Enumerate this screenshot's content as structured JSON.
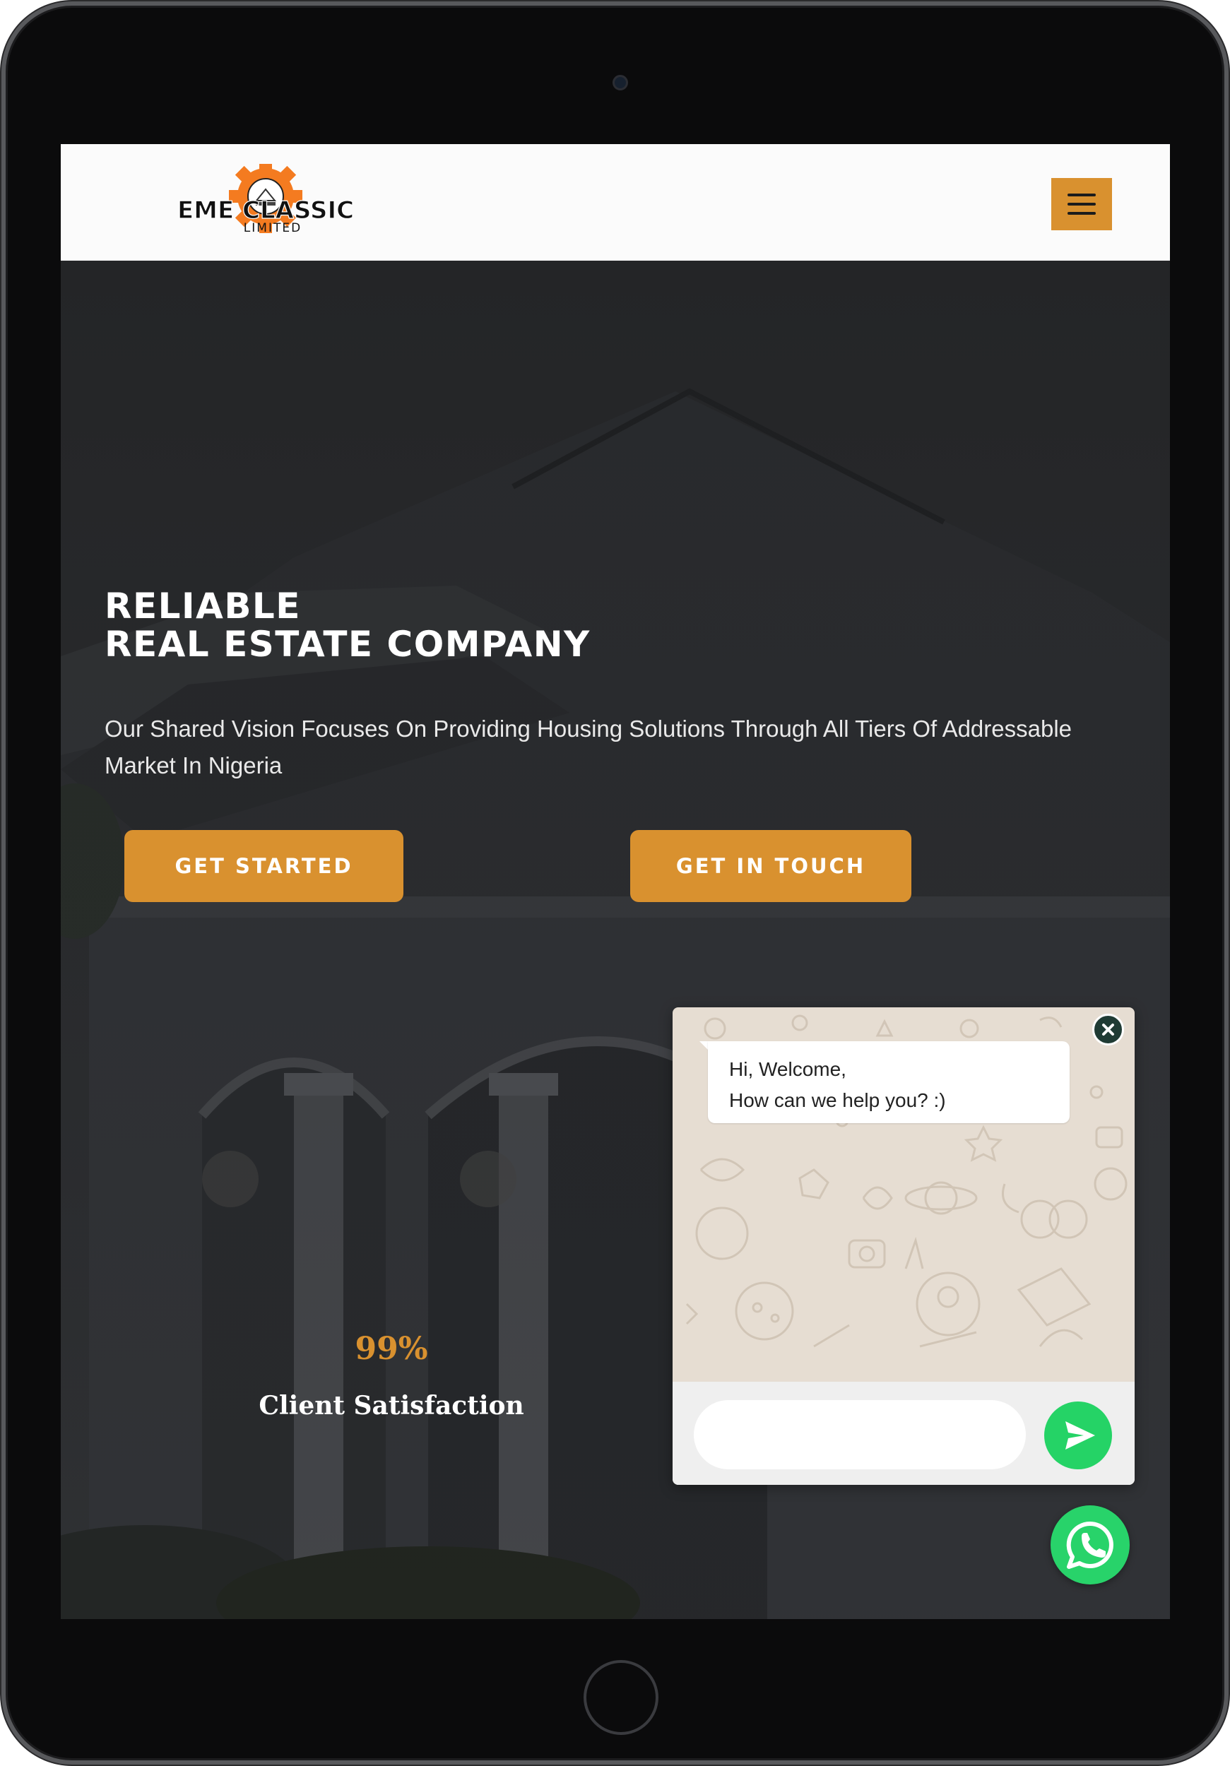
{
  "header": {
    "logo": {
      "brand": "EME CLASSIC",
      "suffix": "LIMITED",
      "accent_color": "#f47b20"
    },
    "menu_icon": "hamburger-menu-icon",
    "menu_color": "#d9912f"
  },
  "hero": {
    "title_line1": "RELIABLE",
    "title_line2": "REAL ESTATE COMPANY",
    "description": "Our Shared Vision Focuses On Providing Housing Solutions Through All Tiers Of Addressable Market In Nigeria",
    "buttons": {
      "get_started": "GET STARTED",
      "get_in_touch": "GET IN TOUCH"
    },
    "stat": {
      "value": "99%",
      "label": "Client Satisfaction"
    },
    "accent_color": "#d9912f"
  },
  "chat_widget": {
    "greeting_line1": "Hi, Welcome,",
    "greeting_line2": "How can we help you? :)",
    "input_value": "",
    "close_icon": "close-icon",
    "send_icon": "send-icon",
    "brand_color": "#25d366"
  },
  "whatsapp_button": {
    "icon": "whatsapp-icon",
    "color": "#28d36a"
  }
}
